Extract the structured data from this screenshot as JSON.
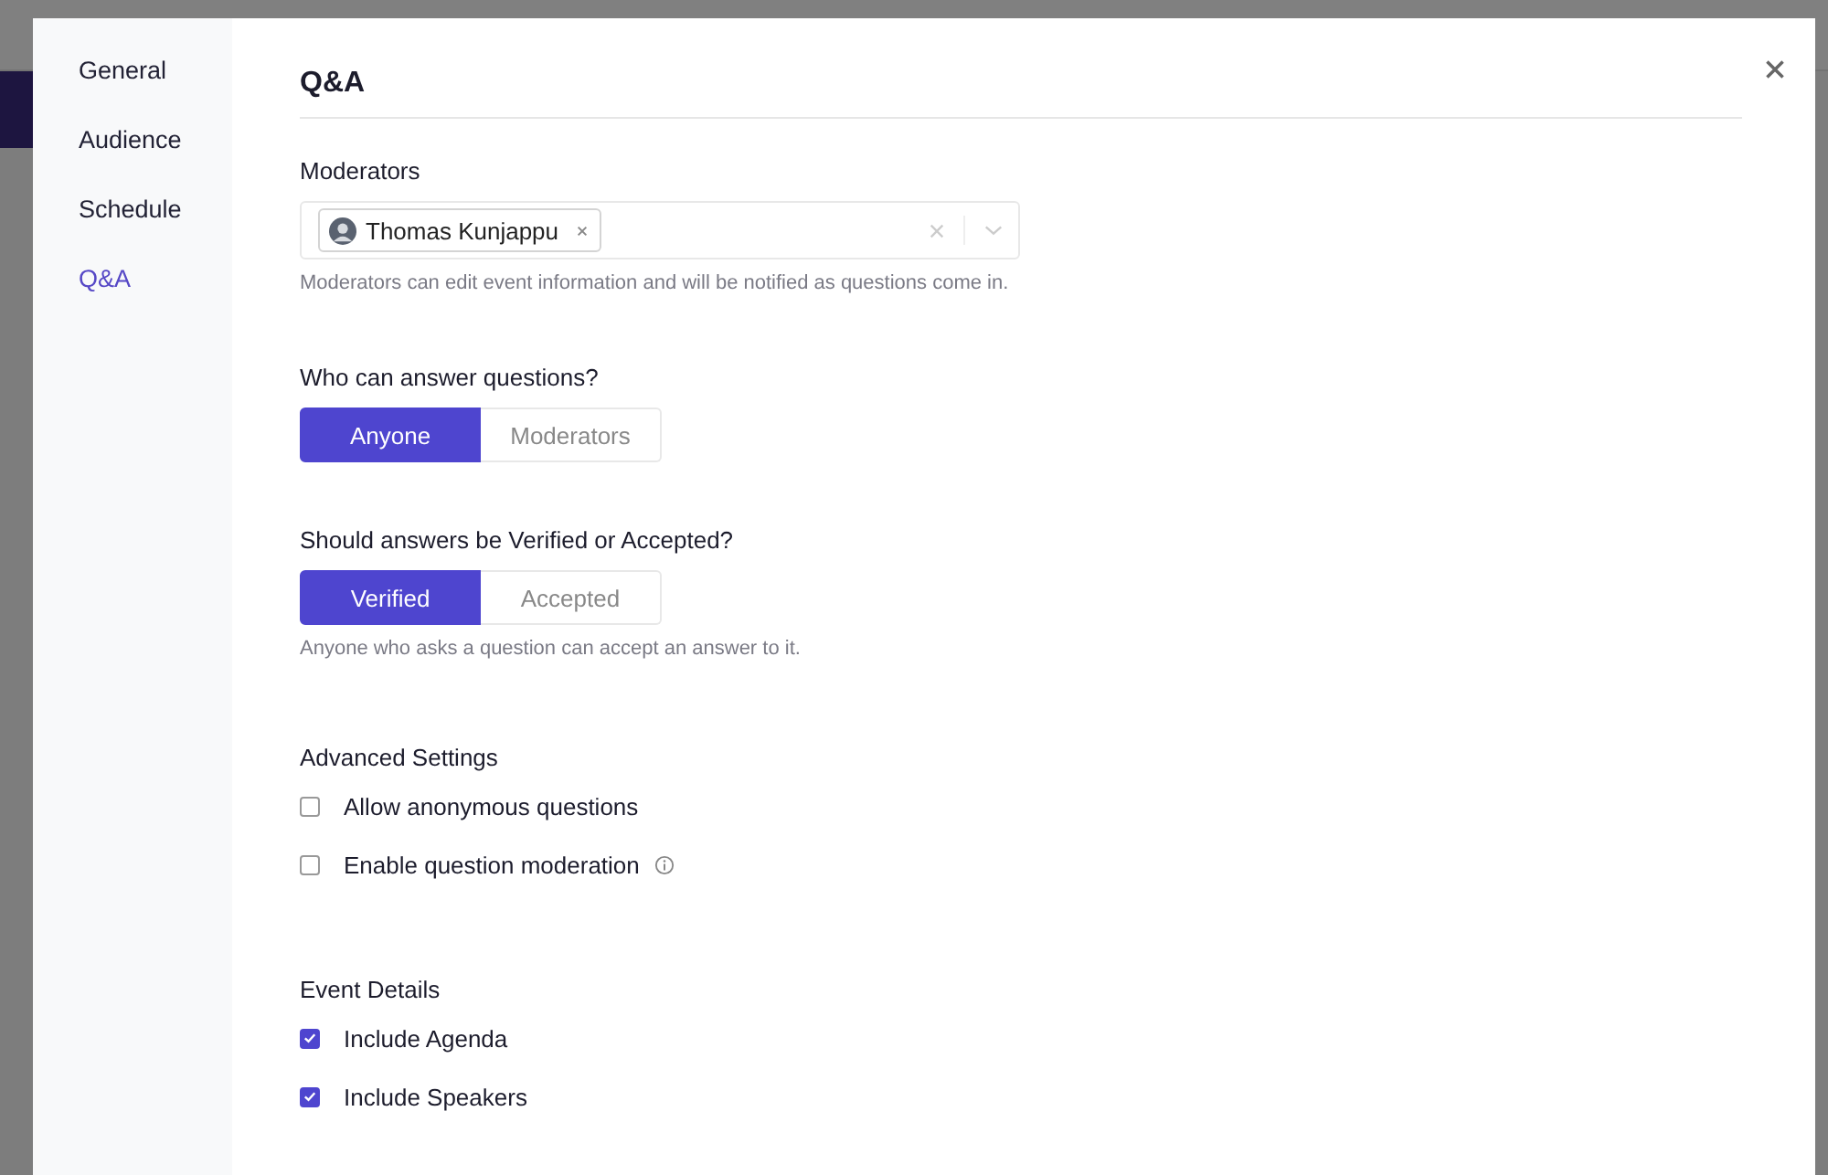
{
  "sidebar": {
    "items": [
      {
        "label": "General",
        "selected": false
      },
      {
        "label": "Audience",
        "selected": false
      },
      {
        "label": "Schedule",
        "selected": false
      },
      {
        "label": "Q&A",
        "selected": true
      }
    ]
  },
  "heading": "Q&A",
  "moderators": {
    "label": "Moderators",
    "chips": [
      {
        "name": "Thomas Kunjappu"
      }
    ],
    "help": "Moderators can edit event information and will be notified as questions come in."
  },
  "segments": [
    {
      "label": "Who can answer questions?",
      "options": [
        {
          "label": "Anyone",
          "selected": true
        },
        {
          "label": "Moderators",
          "selected": false
        }
      ]
    },
    {
      "label": "Should answers be Verified or Accepted?",
      "options": [
        {
          "label": "Verified",
          "selected": true
        },
        {
          "label": "Accepted",
          "selected": false
        }
      ],
      "help": "Anyone who asks a question can accept an answer to it."
    }
  ],
  "checkgroups": [
    {
      "label": "Advanced Settings",
      "items": [
        {
          "label": "Allow anonymous questions",
          "checked": false,
          "info": false
        },
        {
          "label": "Enable question moderation",
          "checked": false,
          "info": true
        }
      ]
    },
    {
      "label": "Event Details",
      "items": [
        {
          "label": "Include Agenda",
          "checked": true,
          "info": false
        },
        {
          "label": "Include Speakers",
          "checked": true,
          "info": false
        }
      ]
    }
  ]
}
